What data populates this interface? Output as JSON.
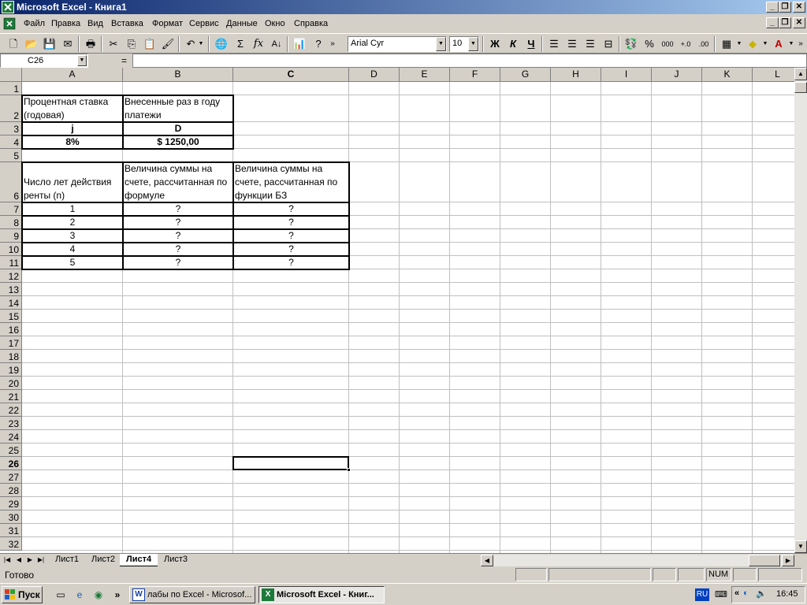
{
  "window": {
    "title": "Microsoft Excel - Книга1"
  },
  "menu": [
    "Файл",
    "Правка",
    "Вид",
    "Вставка",
    "Формат",
    "Сервис",
    "Данные",
    "Окно",
    "Справка"
  ],
  "toolbar": {
    "font_name": "Arial Cyr",
    "font_size": "10",
    "sum_symbol": "Σ",
    "fx_symbol": "fx",
    "bold_label": "Ж",
    "italic_label": "К",
    "underline_label": "Ч",
    "percent_label": "%",
    "thousands_label": "000"
  },
  "formula_bar": {
    "name_box": "C26",
    "equals": "=",
    "value": ""
  },
  "columns": [
    "A",
    "B",
    "C",
    "D",
    "E",
    "F",
    "G",
    "H",
    "I",
    "J",
    "K",
    "L"
  ],
  "rows": [
    "1",
    "2",
    "3",
    "4",
    "5",
    "6",
    "7",
    "8",
    "9",
    "10",
    "11",
    "12",
    "13",
    "14",
    "15",
    "16",
    "17",
    "18",
    "19",
    "20",
    "21",
    "22",
    "23",
    "24",
    "25",
    "26",
    "27",
    "28",
    "29",
    "30",
    "31",
    "32"
  ],
  "active_cell": "C26",
  "cells": {
    "A2": "Процентная ставка (годовая)",
    "B2": "Внесенные раз в году платежи",
    "A3": "j",
    "B3": "D",
    "A4": "8%",
    "B4": "$ 1250,00",
    "A6": "Число лет действия ренты (n)",
    "B6": "Величина суммы на счете, рассчитанная по формуле",
    "C6": "Величина суммы на счете, рассчитанная по функции БЗ",
    "A7": "1",
    "B7": "?",
    "C7": "?",
    "A8": "2",
    "B8": "?",
    "C8": "?",
    "A9": "3",
    "B9": "?",
    "C9": "?",
    "A10": "4",
    "B10": "?",
    "C10": "?",
    "A11": "5",
    "B11": "?",
    "C11": "?"
  },
  "sheet_tabs": [
    "Лист1",
    "Лист2",
    "Лист4",
    "Лист3"
  ],
  "active_sheet": "Лист4",
  "status": {
    "text": "Готово",
    "num": "NUM"
  },
  "taskbar": {
    "start": "Пуск",
    "tasks": [
      "лабы по Excel - Microsof...",
      "Microsoft Excel - Книг..."
    ],
    "lang": "RU",
    "clock": "16:45",
    "chevron": "«",
    "ql_chevron": "»"
  },
  "colors": {
    "title_start": "#0a246a",
    "title_end": "#a6caf0",
    "face": "#d4d0c8",
    "excel_green": "#1d7a3a"
  }
}
